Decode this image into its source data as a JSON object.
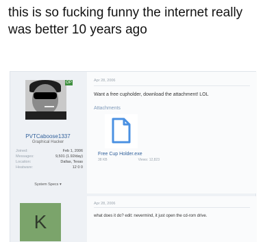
{
  "caption": "this is so fucking funny the internet really was better 10 years ago",
  "post1": {
    "date": "Apr 28, 2006",
    "message": "Want a free cupholder, download the attachment! LOL",
    "attachments_label": "Attachments",
    "attachment": {
      "filename": "Free Cup Holder.exe",
      "size": "38 KB",
      "views": "Views: 12,823"
    },
    "user": {
      "badge": "OP",
      "name": "PVTCaboose1337",
      "title": "Graphical Hacker",
      "stats": [
        {
          "label": "Joined:",
          "value": "Feb 1, 2006"
        },
        {
          "label": "Messages:",
          "value": "9,501 (1.92/day)"
        },
        {
          "label": "Location:",
          "value": "Dallas, Texas"
        },
        {
          "label": "Heatware:",
          "value": "12 0 0"
        }
      ],
      "specs": "System Specs ▾"
    }
  },
  "post2": {
    "date": "Apr 28, 2006",
    "avatar_letter": "K",
    "message": "what does it do? edit: nevermind, it just open the cd-rom drive."
  },
  "colors": {
    "link": "#2f5f9a",
    "muted": "#9aa4ae",
    "badge": "#3f8f3f",
    "avatar_k": "#7ba46b",
    "file_icon": "#4a90e2"
  }
}
